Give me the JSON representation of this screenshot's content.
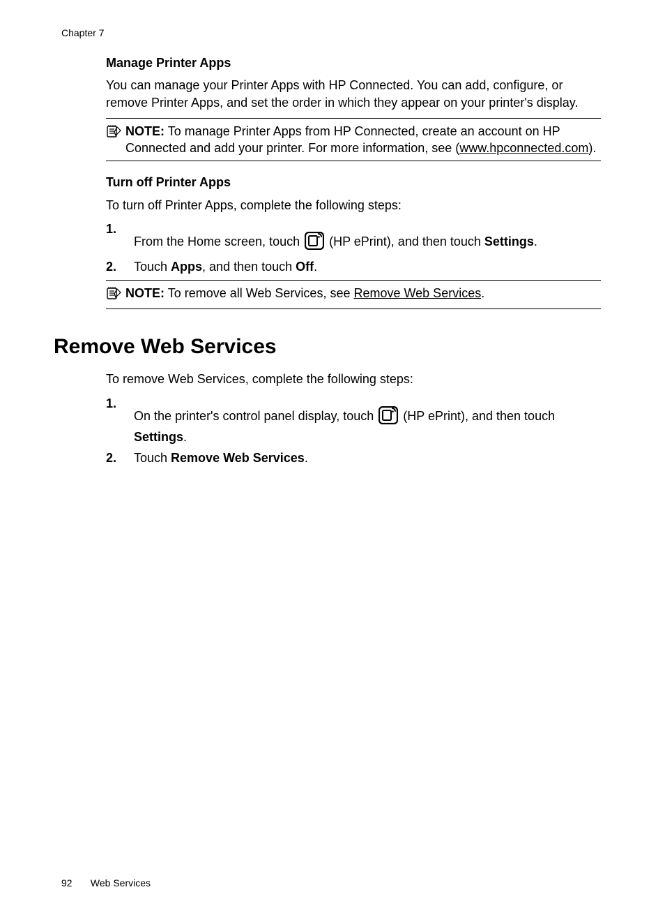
{
  "header": {
    "chapter": "Chapter 7"
  },
  "section1": {
    "title": "Manage Printer Apps",
    "para": "You can manage your Printer Apps with HP Connected. You can add, configure, or remove Printer Apps, and set the order in which they appear on your printer's display.",
    "note": {
      "label": "NOTE:",
      "text_before_link": "To manage Printer Apps from HP Connected, create an account on HP Connected and add your printer. For more information, see (",
      "link": "www.hpconnected.com",
      "text_after_link": ")."
    }
  },
  "section2": {
    "title": "Turn off Printer Apps",
    "intro": "To turn off Printer Apps, complete the following steps:",
    "step1": {
      "num": "1.",
      "before": "From the Home screen, touch ",
      "after1": " (HP ePrint), and then touch ",
      "settings": "Settings",
      "after2": "."
    },
    "step2": {
      "num": "2.",
      "t1": "Touch ",
      "apps": "Apps",
      "t2": ", and then touch ",
      "off": "Off",
      "t3": "."
    },
    "note": {
      "label": "NOTE:",
      "text": "To remove all Web Services, see ",
      "link": "Remove Web Services",
      "after": "."
    }
  },
  "section3": {
    "title": "Remove Web Services",
    "intro": "To remove Web Services, complete the following steps:",
    "step1": {
      "num": "1.",
      "before": "On the printer's control panel display, touch ",
      "after1": " (HP ePrint), and then touch ",
      "settings": "Settings",
      "after2": "."
    },
    "step2": {
      "num": "2.",
      "t1": "Touch ",
      "rws": "Remove Web Services",
      "t2": "."
    }
  },
  "footer": {
    "page": "92",
    "section": "Web Services"
  }
}
